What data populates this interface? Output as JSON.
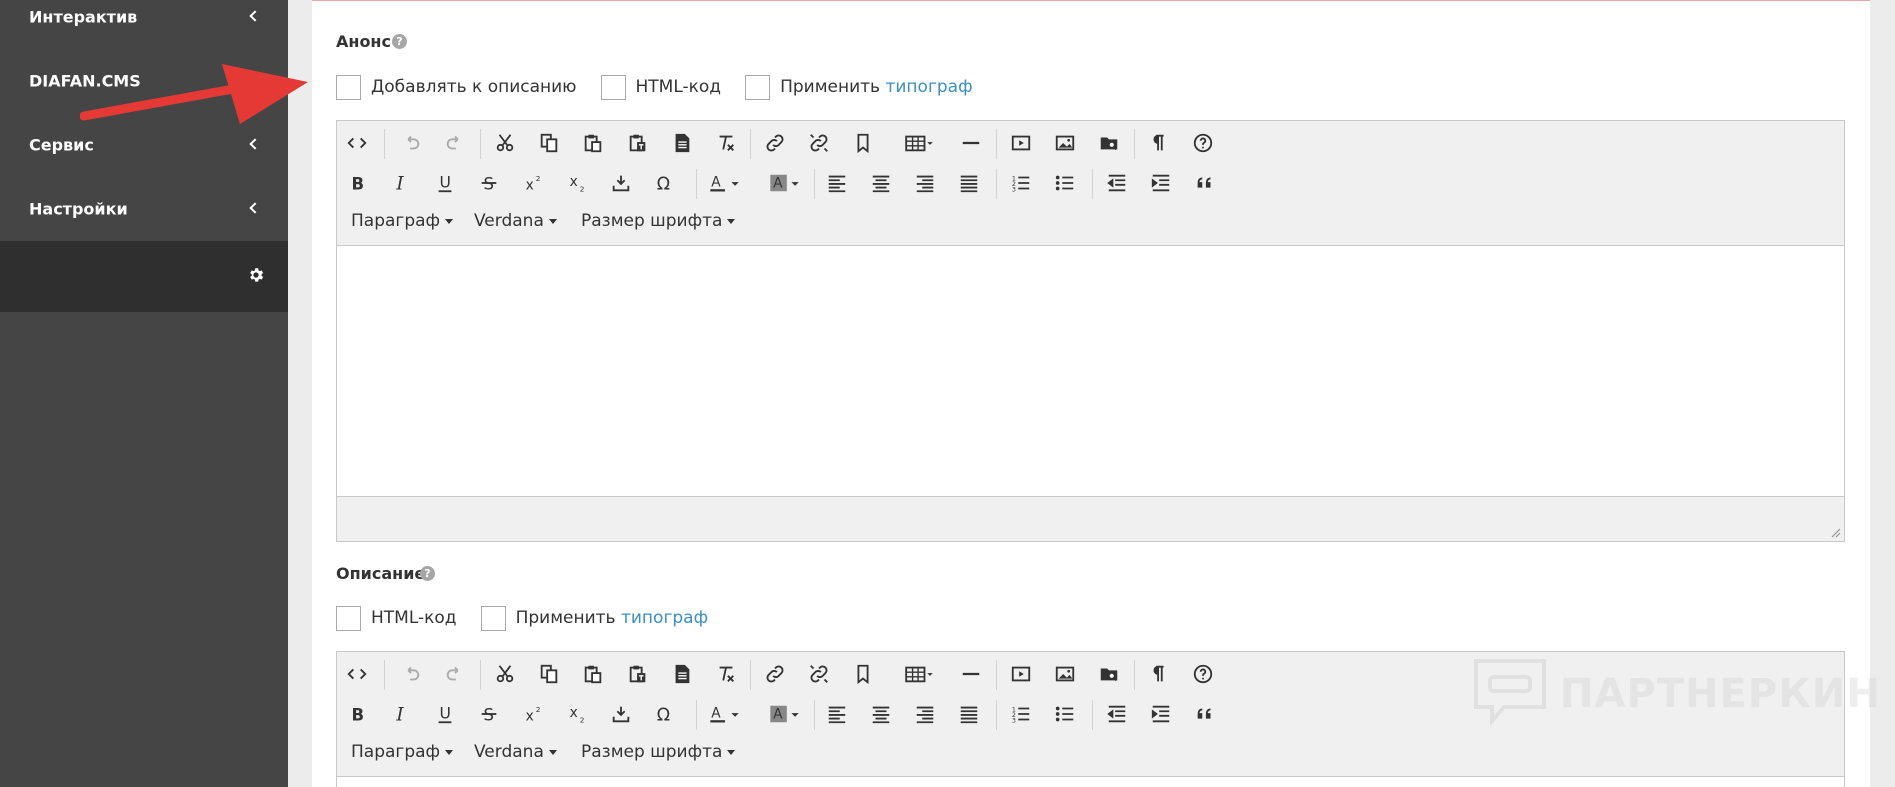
{
  "sidebar": {
    "items": [
      {
        "label": "Интерактив"
      },
      {
        "label": "DIAFAN.CMS"
      },
      {
        "label": "Сервис"
      },
      {
        "label": "Настройки"
      }
    ]
  },
  "announce": {
    "title": "Анонс",
    "help": "?",
    "checkboxes": [
      {
        "label": "Добавлять к описанию"
      },
      {
        "label": "HTML-код"
      },
      {
        "label_prefix": "Применить",
        "link": "типограф"
      }
    ]
  },
  "description": {
    "title": "Описание",
    "help": "?",
    "checkboxes": [
      {
        "label": "HTML-код"
      },
      {
        "label_prefix": "Применить",
        "link": "типограф"
      }
    ]
  },
  "editor": {
    "format_label": "Параграф",
    "font_label": "Verdana",
    "size_label": "Размер шрифта"
  },
  "watermark": {
    "text": "ПАРТНЕРКИН"
  },
  "colors": {
    "accent": "#3a8fc3",
    "sidebar": "#454545",
    "arrow": "#e53935"
  }
}
